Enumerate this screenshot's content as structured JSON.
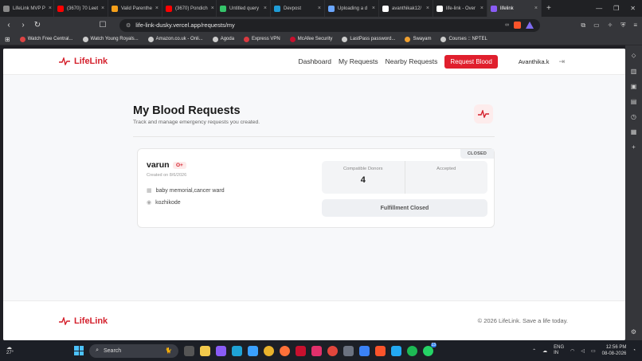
{
  "browser": {
    "tabs": [
      {
        "label": "LifeLink MVP P",
        "color": "#888888"
      },
      {
        "label": "(3670) 70 Leet",
        "color": "#ff0000"
      },
      {
        "label": "Valid Parenthe",
        "color": "#f6a01a"
      },
      {
        "label": "(3670) Pondich",
        "color": "#ff0000"
      },
      {
        "label": "Untitled query",
        "color": "#35c46a"
      },
      {
        "label": "Devpost",
        "color": "#1f9cd6"
      },
      {
        "label": "Uploading a d",
        "color": "#6aa6ff"
      },
      {
        "label": "avanthikak12/",
        "color": "#ffffff"
      },
      {
        "label": "life-link - Over",
        "color": "#ffffff"
      },
      {
        "label": "lifelink",
        "color": "#8a5cf6"
      }
    ],
    "new_tab": "+",
    "url": "life-link-dusky.vercel.app/requests/my",
    "bookmarks": [
      {
        "label": "Watch Free Central...",
        "color": "#d44"
      },
      {
        "label": "Watch Young Royals...",
        "color": "#ccc"
      },
      {
        "label": "Amazon.co.uk - Onli...",
        "color": "#ccc"
      },
      {
        "label": "Agoda",
        "color": "#ccc"
      },
      {
        "label": "Express VPN",
        "color": "#da3940"
      },
      {
        "label": "McAfee Security",
        "color": "#c8102e"
      },
      {
        "label": "LastPass password...",
        "color": "#ccc"
      },
      {
        "label": "Swayam",
        "color": "#f0a030"
      },
      {
        "label": "Courses :: NPTEL",
        "color": "#ccc"
      }
    ]
  },
  "app": {
    "brand": "LifeLink",
    "nav": {
      "dashboard": "Dashboard",
      "my_requests": "My Requests",
      "nearby": "Nearby Requests",
      "request_blood": "Request Blood",
      "user": "Avanthika.k"
    },
    "page_title": "My Blood Requests",
    "page_subtitle": "Track and manage emergency requests you created.",
    "request": {
      "status": "CLOSED",
      "name": "varun",
      "blood_type": "O+",
      "created": "Created on 8/6/2026",
      "hospital": "baby memorial,cancer ward",
      "city": "kozhikode",
      "stats": {
        "compatible_label": "Compatible Donors",
        "compatible_value": "4",
        "accepted_label": "Accepted",
        "accepted_value": ""
      },
      "action": "Fulfillment Closed"
    },
    "footer": {
      "brand": "LifeLink",
      "copyright": "© 2026 LifeLink. Save a life today."
    }
  },
  "taskbar": {
    "temp": "27°",
    "search": "Search",
    "lang": "ENG",
    "region": "IN",
    "time": "12:56 PM",
    "date": "08-08-2026",
    "badge": "13"
  }
}
